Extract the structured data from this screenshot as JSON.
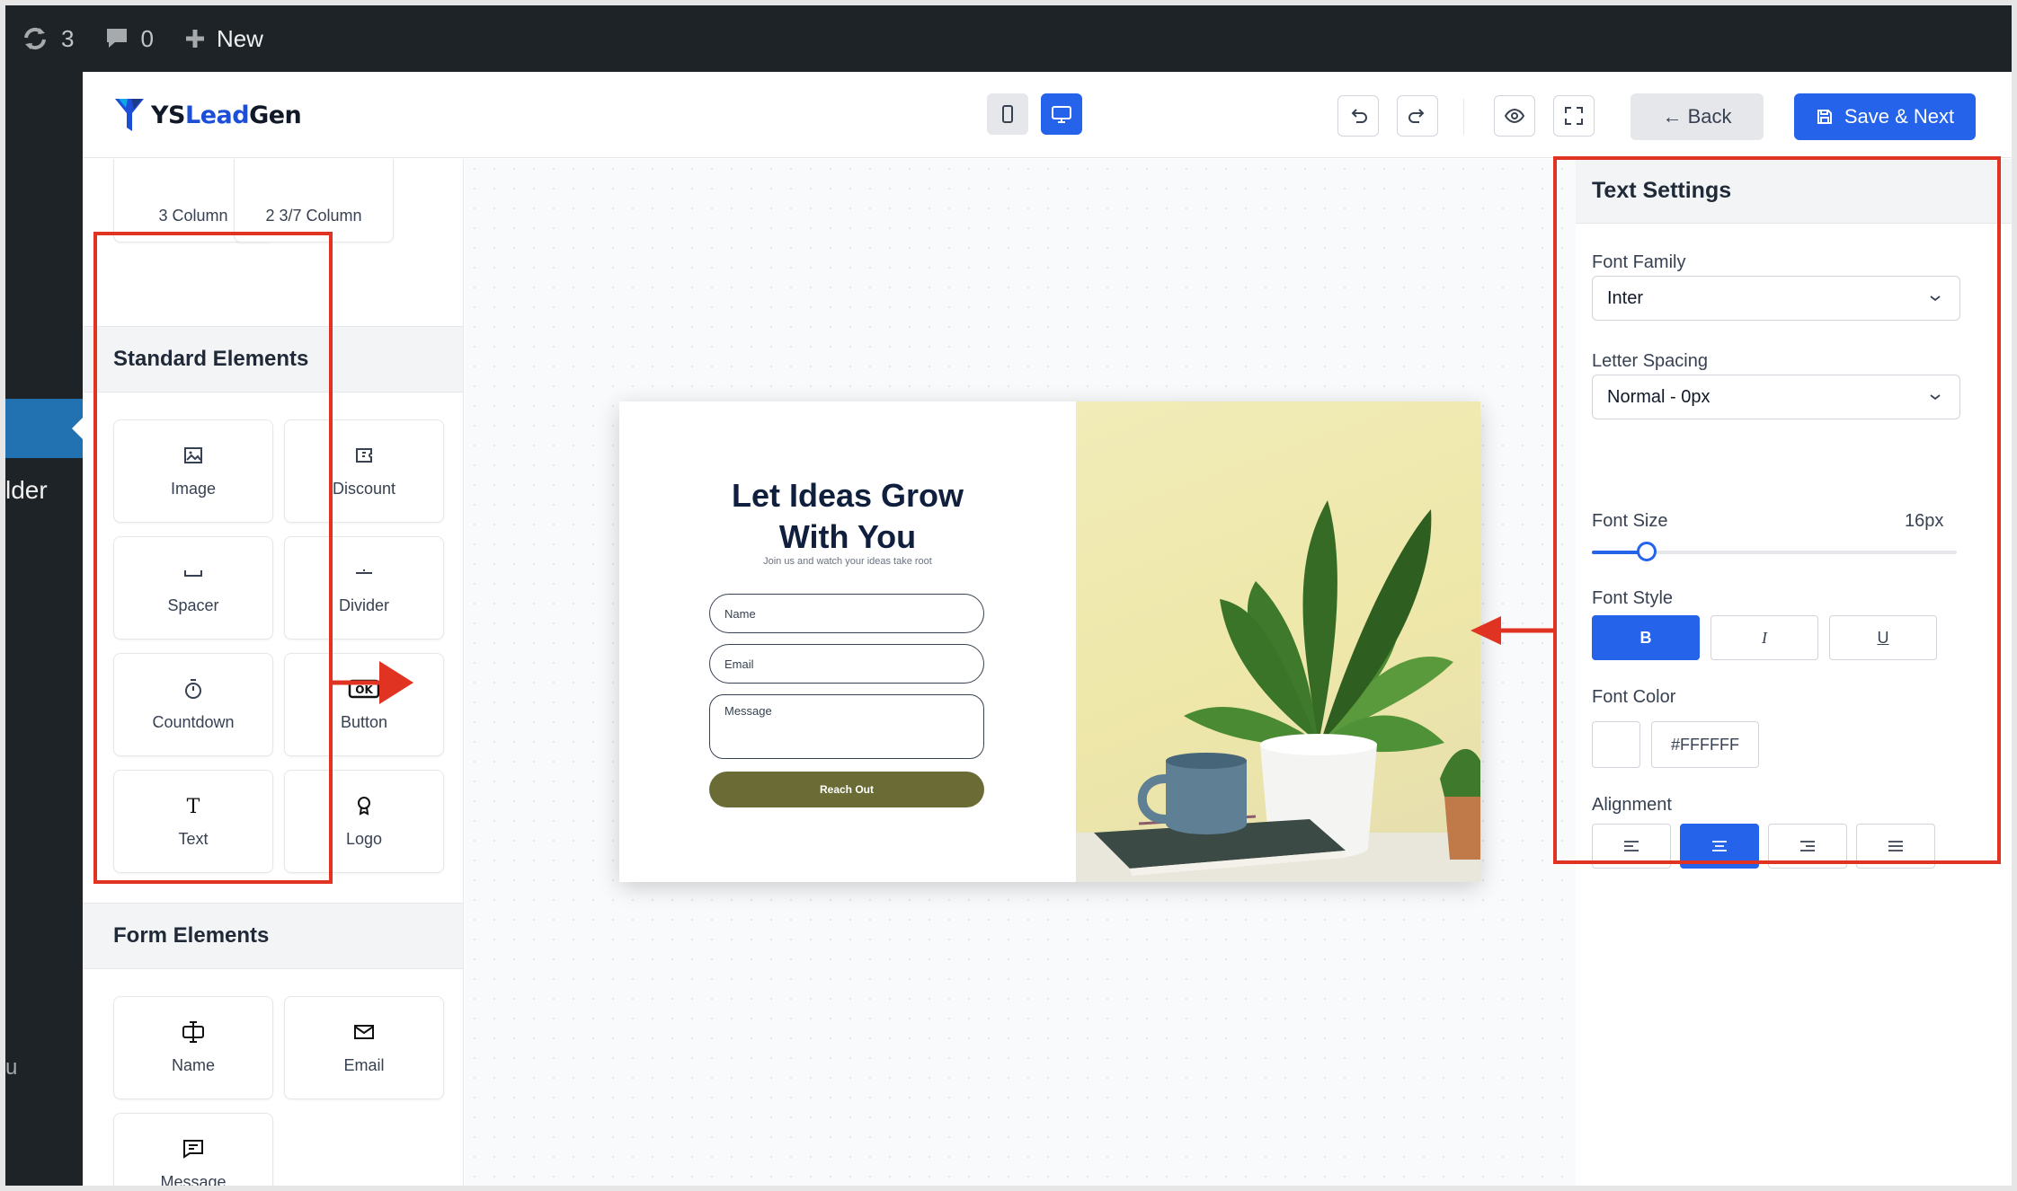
{
  "admin_bar": {
    "updates_count": "3",
    "comments_count": "0",
    "new_label": "New"
  },
  "wp_sidebar": {
    "active_label_fragment": "lder",
    "bottom_fragment": "u"
  },
  "app": {
    "logo": {
      "prefix": "YS",
      "middle": "Lead",
      "suffix": "Gen"
    },
    "toolbar": {
      "back_label": "← Back",
      "save_label": "Save & Next"
    }
  },
  "left_panel": {
    "layout_tiles": [
      {
        "label": "3 Column",
        "icon": "three-column-icon"
      },
      {
        "label": "2 3/7 Column",
        "icon": "two-column-icon"
      }
    ],
    "standard_title": "Standard Elements",
    "standard_elements": [
      {
        "label": "Image",
        "icon": "image-icon"
      },
      {
        "label": "Discount",
        "icon": "ticket-icon"
      },
      {
        "label": "Spacer",
        "icon": "spacer-icon"
      },
      {
        "label": "Divider",
        "icon": "divider-icon"
      },
      {
        "label": "Countdown",
        "icon": "timer-icon"
      },
      {
        "label": "Button",
        "icon": "ok-button-icon"
      },
      {
        "label": "Text",
        "icon": "text-icon"
      },
      {
        "label": "Logo",
        "icon": "badge-icon"
      }
    ],
    "form_title": "Form Elements",
    "form_elements": [
      {
        "label": "Name",
        "icon": "text-cursor-icon"
      },
      {
        "label": "Email",
        "icon": "envelope-icon"
      },
      {
        "label": "Message",
        "icon": "message-icon"
      }
    ]
  },
  "canvas": {
    "title_line1": "Let Ideas Grow",
    "title_line2": "With You",
    "subtitle": "Join us and watch your ideas take root",
    "name_placeholder": "Name",
    "email_placeholder": "Email",
    "message_placeholder": "Message",
    "cta_label": "Reach Out"
  },
  "settings": {
    "title": "Text Settings",
    "font_family_label": "Font Family",
    "font_family_value": "Inter",
    "letter_spacing_label": "Letter Spacing",
    "letter_spacing_value": "Normal - 0px",
    "font_size_label": "Font Size",
    "font_size_value": "16px",
    "font_size_level": 0.15,
    "font_style_label": "Font Style",
    "style_bold": "B",
    "style_italic": "I",
    "style_underline": "U",
    "font_color_label": "Font Color",
    "font_color_value": "#FFFFFF",
    "alignment_label": "Alignment",
    "alignment_selected": "center"
  },
  "colors": {
    "accent": "#2563eb",
    "annotation": "#e03322",
    "cta": "#6b6b36",
    "wp_admin": "#1d2327"
  }
}
